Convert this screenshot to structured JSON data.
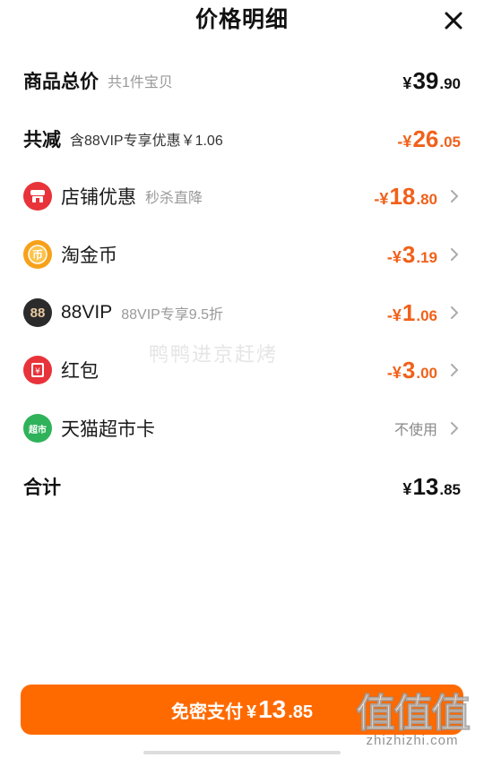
{
  "header": {
    "title": "价格明细"
  },
  "rows": {
    "total": {
      "label": "商品总价",
      "sub": "共1件宝贝",
      "sym": "¥",
      "int": "39",
      "dec": ".90"
    },
    "reduce": {
      "label": "共减",
      "sub": "含88VIP专享优惠￥1.06",
      "sym": "-¥",
      "int": "26",
      "dec": ".05"
    },
    "shop": {
      "label": "店铺优惠",
      "sub": "秒杀直降",
      "sym": "-¥",
      "int": "18",
      "dec": ".80"
    },
    "coin": {
      "label": "淘金币",
      "sym": "-¥",
      "int": "3",
      "dec": ".19"
    },
    "vip": {
      "label": "88VIP",
      "sub": "88VIP专享9.5折",
      "icon_text": "88",
      "sym": "-¥",
      "int": "1",
      "dec": ".06"
    },
    "redpacket": {
      "label": "红包",
      "sym": "-¥",
      "int": "3",
      "dec": ".00"
    },
    "tmall": {
      "label": "天猫超市卡",
      "icon_text": "超市",
      "value": "不使用"
    },
    "sum": {
      "label": "合计",
      "sym": "¥",
      "int": "13",
      "dec": ".85"
    }
  },
  "watermark": "鸭鸭进京赶烤",
  "pay": {
    "label": "免密支付",
    "sym": "¥",
    "int": "13",
    "dec": ".85"
  },
  "corner_logo": {
    "text": "值值值",
    "sub": "zhizhizhi.com"
  },
  "colors": {
    "accent": "#ff6a00",
    "discount": "#f0611a",
    "shop_icon": "#e8333a",
    "coin_icon": "#f7a11a",
    "vip_icon": "#2b2b2b",
    "redpacket_icon": "#e8333a",
    "tmall_icon": "#2fb25a"
  },
  "icons": {
    "close": "close-icon",
    "chevron": "chevron-right-icon",
    "shop": "shop-icon",
    "coin": "coin-icon",
    "vip": "vip-88-icon",
    "redpacket": "redpacket-icon",
    "tmall": "tmall-supermarket-icon"
  }
}
